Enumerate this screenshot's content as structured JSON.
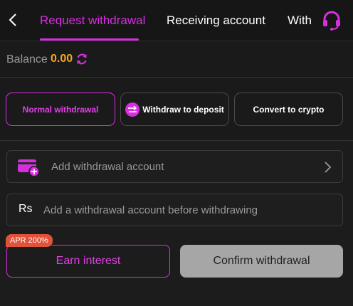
{
  "header": {
    "tabs": [
      {
        "label": "Request withdrawal",
        "active": true
      },
      {
        "label": "Receiving account",
        "active": false
      },
      {
        "label": "With",
        "active": false
      }
    ],
    "back_icon": "chevron-left-icon",
    "support_icon": "headset-icon"
  },
  "balance": {
    "label": "Balance",
    "value": "0.00",
    "refresh_icon": "refresh-icon"
  },
  "methods": [
    {
      "label": "Normal withdrawal",
      "selected": true
    },
    {
      "label": "Withdraw to deposit",
      "icon": "transfer-icon"
    },
    {
      "label": "Convert to crypto"
    }
  ],
  "account_row": {
    "placeholder": "Add withdrawal account",
    "icon": "card-add-icon"
  },
  "amount_row": {
    "currency_symbol": "Rs",
    "placeholder": "Add a withdrawal account before withdrawing"
  },
  "actions": {
    "apr_badge": "APR 200%",
    "earn_label": "Earn interest",
    "confirm_label": "Confirm withdrawal"
  },
  "colors": {
    "accent": "#d62fe0",
    "balance": "#f5a623",
    "badge": "#e0523a",
    "confirm_disabled": "#a6a6a6"
  }
}
